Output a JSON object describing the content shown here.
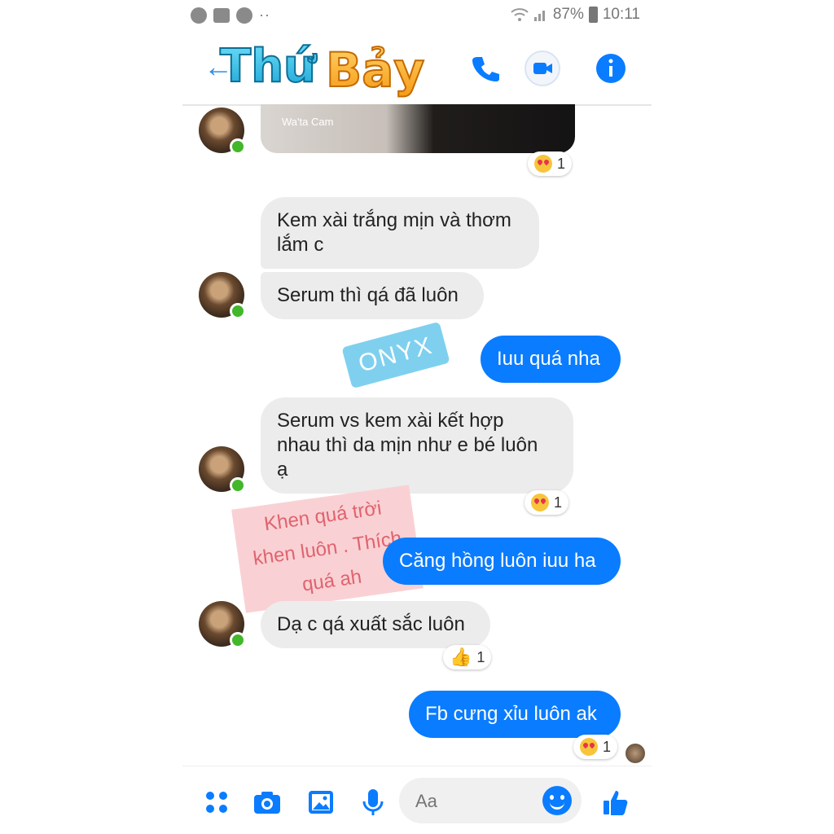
{
  "status_bar": {
    "battery": "87%",
    "time": "10:11",
    "dots": "··"
  },
  "header": {
    "logo_text": "ThứBảy",
    "icons": [
      "back-arrow-icon",
      "phone-icon",
      "video-call-icon",
      "info-icon"
    ]
  },
  "messages": [
    {
      "side": "in",
      "text_lines": [
        "Kem xài trắng mịn và thơm",
        "lắm c"
      ]
    },
    {
      "side": "in",
      "text_lines": [
        "Serum thì qá đã luôn"
      ]
    },
    {
      "side": "out",
      "text_lines": [
        "Iuu quá nha"
      ]
    },
    {
      "side": "in",
      "text_lines": [
        "Serum vs kem xài kết hợp",
        "nhau thì da mịn như e bé luôn",
        "ạ"
      ]
    },
    {
      "side": "out",
      "text_lines": [
        "Căng hồng luôn iuu ha"
      ]
    },
    {
      "side": "in",
      "text_lines": [
        "Dạ c qá xuất sắc luôn"
      ]
    },
    {
      "side": "out",
      "text_lines": [
        "Fb cưng xỉu luôn ak"
      ]
    }
  ],
  "reactions": [
    {
      "emoji": "heart-eyes",
      "count": "1"
    },
    {
      "emoji": "heart-eyes",
      "count": "1"
    },
    {
      "emoji": "thumbs-up",
      "count": "1"
    },
    {
      "emoji": "heart-eyes",
      "count": "1"
    }
  ],
  "stickers": {
    "onyx": "ONYX",
    "khen_lines": [
      "Khen quá trời",
      "khen luôn . Thích",
      "quá ah"
    ]
  },
  "photo_watermark": "Wa'ta Cam",
  "composer": {
    "placeholder": "Aa"
  },
  "colors": {
    "accent": "#0a7cff",
    "incoming_bubble": "#ececec"
  }
}
